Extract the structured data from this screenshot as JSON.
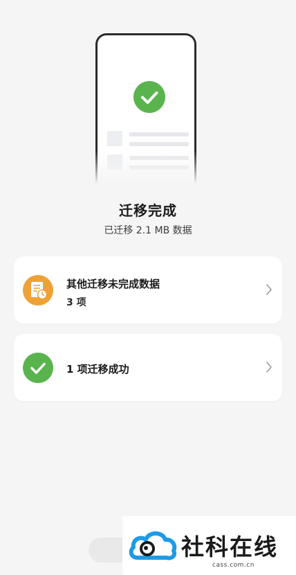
{
  "result": {
    "title": "迁移完成",
    "subtitle": "已迁移 2.1 MB 数据"
  },
  "cards": [
    {
      "icon": "document-clock-icon",
      "title": "其他迁移未完成数据",
      "subtitle": "3 项"
    },
    {
      "icon": "check-circle-icon",
      "title": "1 项迁移成功"
    }
  ],
  "watermark": {
    "text": "社科在线",
    "domain": "cass.com.cn"
  },
  "colors": {
    "success_green": "#5ab44e",
    "warning_orange": "#f0a136",
    "background": "#f5f5f5",
    "card": "#ffffff"
  }
}
